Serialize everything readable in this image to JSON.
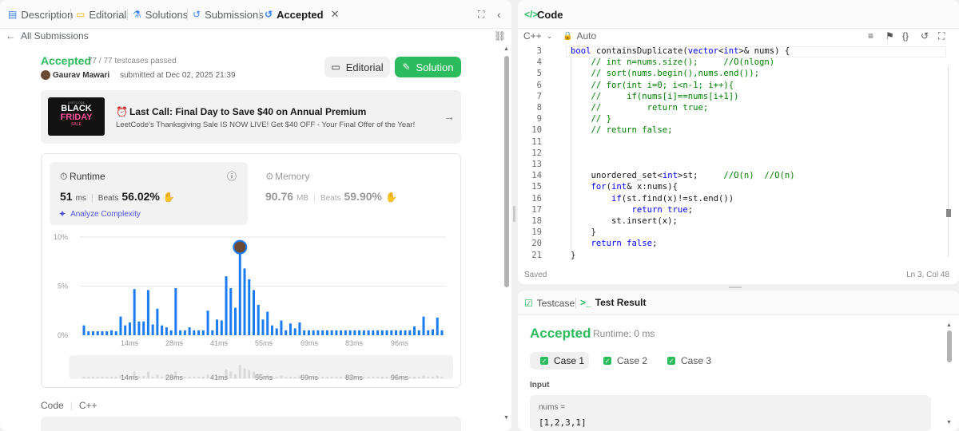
{
  "left_tabs": {
    "description": "Description",
    "editorial": "Editorial",
    "solutions": "Solutions",
    "submissions": "Submissions",
    "accepted": "Accepted"
  },
  "back": {
    "label": "All Submissions"
  },
  "result": {
    "status": "Accepted",
    "testcases": "77 / 77 testcases passed",
    "user": "Gaurav Mawari",
    "submitted_at": "submitted at Dec 02, 2025 21:39"
  },
  "actions": {
    "editorial": "Editorial",
    "solution": "Solution"
  },
  "promo": {
    "title": "Last Call: Final Day to Save $40 on Annual Premium",
    "desc": "LeetCode's Thanksgiving Sale IS NOW LIVE! Get $40 OFF - Your Final Offer of the Year!",
    "img_small": "LEETCODE",
    "img_line1": "BLACK",
    "img_line2": "FRIDAY",
    "img_line3": "SALE"
  },
  "runtime": {
    "label": "Runtime",
    "value": "51",
    "unit": "ms",
    "beats_label": "Beats",
    "beats": "56.02%",
    "analyze": "Analyze Complexity"
  },
  "memory": {
    "label": "Memory",
    "value": "90.76",
    "unit": "MB",
    "beats_label": "Beats",
    "beats": "59.90%"
  },
  "bottom": {
    "code_label": "Code",
    "lang": "C++"
  },
  "chart_data": {
    "type": "bar",
    "ylabel_ticks": [
      "10%",
      "5%",
      "0%"
    ],
    "ylim": [
      0,
      10
    ],
    "x_ticks": [
      "14ms",
      "28ms",
      "41ms",
      "55ms",
      "69ms",
      "83ms",
      "96ms"
    ],
    "values": [
      1,
      0.4,
      0.4,
      0.4,
      0.4,
      0.4,
      0.5,
      0.4,
      1.9,
      1,
      1.3,
      4.7,
      1.4,
      1.4,
      4.6,
      1.1,
      2.7,
      1,
      0.8,
      0.5,
      4.8,
      0.5,
      0.5,
      0.8,
      0.5,
      0.5,
      0.5,
      2.5,
      0.5,
      1.6,
      1.5,
      6,
      4.8,
      2.8,
      9.3,
      6.8,
      5.7,
      4.6,
      3.1,
      1.6,
      2.4,
      1,
      0.7,
      1.5,
      0.5,
      1.2,
      0.7,
      1.3,
      0.5,
      0.5,
      0.5,
      0.5,
      0.5,
      0.5,
      0.5,
      0.5,
      0.5,
      0.5,
      0.5,
      0.5,
      0.5,
      0.5,
      0.5,
      0.5,
      0.5,
      0.5,
      0.5,
      0.5,
      0.5,
      0.5,
      0.5,
      0.5,
      0.9,
      0.5,
      1.9,
      0.5,
      0.6,
      1.8,
      0.5
    ],
    "highlight_index": 34,
    "colors": {
      "bar": "#1a7cf0",
      "overview": "#d9d9d9",
      "grid": "#e6e6e6"
    }
  },
  "code": {
    "title": "Code",
    "lang": "C++",
    "auto": "Auto",
    "footer_left": "Saved",
    "footer_right": "Ln 3, Col 48",
    "lines": [
      {
        "n": "3",
        "segs": [
          [
            "kw",
            "bool "
          ],
          [
            "",
            "containsDuplicate("
          ],
          [
            "kw",
            "vector"
          ],
          [
            "",
            "<"
          ],
          [
            "kw",
            "int"
          ],
          [
            "",
            ">& nums) {"
          ]
        ]
      },
      {
        "n": "4",
        "segs": [
          [
            "cm",
            "    // int n=nums.size();     //O(nlogn)"
          ]
        ]
      },
      {
        "n": "5",
        "segs": [
          [
            "cm",
            "    // sort(nums.begin(),nums.end());"
          ]
        ]
      },
      {
        "n": "6",
        "segs": [
          [
            "cm",
            "    // for(int i=0; i<n-1; i++){"
          ]
        ]
      },
      {
        "n": "7",
        "segs": [
          [
            "cm",
            "    //     if(nums[i]==nums[i+1])"
          ]
        ]
      },
      {
        "n": "8",
        "segs": [
          [
            "cm",
            "    //         return true;"
          ]
        ]
      },
      {
        "n": "9",
        "segs": [
          [
            "cm",
            "    // }"
          ]
        ]
      },
      {
        "n": "10",
        "segs": [
          [
            "cm",
            "    // return false;"
          ]
        ]
      },
      {
        "n": "11",
        "segs": []
      },
      {
        "n": "12",
        "segs": []
      },
      {
        "n": "13",
        "segs": []
      },
      {
        "n": "14",
        "segs": [
          [
            "",
            "    unordered_set<"
          ],
          [
            "kw",
            "int"
          ],
          [
            "",
            ">st;     "
          ],
          [
            "cm",
            "//O(n)  //O(n)"
          ]
        ]
      },
      {
        "n": "15",
        "segs": [
          [
            "kw",
            "    for"
          ],
          [
            "",
            "("
          ],
          [
            "kw",
            "int"
          ],
          [
            "",
            "& x:nums){"
          ]
        ]
      },
      {
        "n": "16",
        "segs": [
          [
            "kw",
            "        if"
          ],
          [
            "",
            "(st.find(x)!=st.end())"
          ]
        ]
      },
      {
        "n": "17",
        "segs": [
          [
            "kw",
            "            return true"
          ],
          [
            "",
            ";"
          ]
        ]
      },
      {
        "n": "18",
        "segs": [
          [
            "",
            "        st.insert(x);"
          ]
        ]
      },
      {
        "n": "19",
        "segs": [
          [
            "",
            "    }"
          ]
        ]
      },
      {
        "n": "20",
        "segs": [
          [
            "kw",
            "    return false"
          ],
          [
            "",
            ";"
          ]
        ]
      },
      {
        "n": "21",
        "segs": [
          [
            "",
            "}"
          ]
        ]
      }
    ]
  },
  "test": {
    "tab_testcase": "Testcase",
    "tab_result": "Test Result",
    "status": "Accepted",
    "runtime": "Runtime: 0 ms",
    "cases": [
      "Case 1",
      "Case 2",
      "Case 3"
    ],
    "input_label": "Input",
    "var": "nums =",
    "value": "[1,2,3,1]"
  }
}
